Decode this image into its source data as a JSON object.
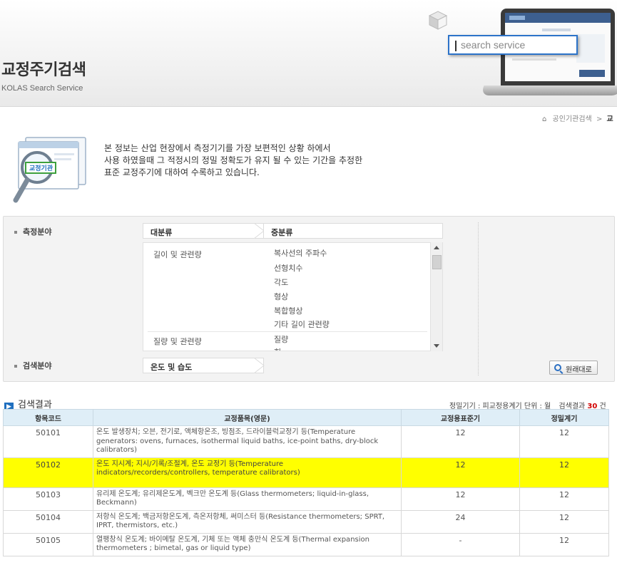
{
  "header": {
    "title": "교정주기검색",
    "subtitle": "KOLAS Search Service",
    "search_placeholder": "search service"
  },
  "breadcrumb": {
    "home_item": "공인기관검색",
    "current": "교"
  },
  "intro": {
    "badge_text": "교정기관",
    "lines": [
      "본 정보는 산업 현장에서 측정기기를 가장 보편적인 상황 하에서",
      "사용 하였을때 그 적정시의 정밀 정확도가 유지 될 수 있는 기간을 추정한",
      "표준 교정주기에 대하여 수록하고 있습니다."
    ]
  },
  "filter": {
    "field_label": "측정분야",
    "col_major": "대분류",
    "col_middle": "중분류",
    "categories": [
      "길이 및 관련량",
      "질량 및 관련량"
    ],
    "subcategories": [
      "복사선의 주파수",
      "선형치수",
      "각도",
      "형상",
      "복합형상",
      "기타 길이 관련량",
      "질량",
      "힘"
    ],
    "search_field_label": "검색분야",
    "search_field_value": "온도 및 습도",
    "reset_label": "원래대로"
  },
  "results": {
    "title": "검색결과",
    "unit_text": "정밀기기 : 피교정용계기 단위 : 월",
    "count_prefix": "검색결과",
    "count": "30",
    "count_suffix": "건",
    "columns": [
      "항목코드",
      "교정품목(영문)",
      "교정용표준기",
      "정밀계기"
    ],
    "rows": [
      {
        "code": "50101",
        "item": "온도 발생장치; 오븐, 전기로, 액체항온조, 빙점조, 드라이블럭교정기 등(Temperature generators: ovens, furnaces, isothermal liquid baths, ice-point baths, dry-block calibrators)",
        "standard": "12",
        "precision": "12"
      },
      {
        "code": "50102",
        "item": "온도 지시계; 지시/기록/조절계, 온도 교정기 등(Temperature indicators/recorders/controllers, temperature calibrators)",
        "standard": "12",
        "precision": "12"
      },
      {
        "code": "50103",
        "item": "유리제 온도계; 유리제온도계, 벡크만 온도계 등(Glass thermometers; liquid-in-glass, Beckmann)",
        "standard": "12",
        "precision": "12"
      },
      {
        "code": "50104",
        "item": "저항식 온도계; 백금저항온도계, 측온저항체, 써미스터 등(Resistance thermometers; SPRT, IPRT, thermistors, etc.)",
        "standard": "24",
        "precision": "12"
      },
      {
        "code": "50105",
        "item": "열팽창식 온도계; 바이메탈 온도계, 기체 또는 액체 충만식 온도계 등(Thermal expansion thermometers ; bimetal, gas or liquid type)",
        "standard": "-",
        "precision": "12"
      }
    ]
  },
  "colors": {
    "highlight": "#ffff00",
    "header_cell": "#dfeef7",
    "accent_blue": "#1f6fbf",
    "count_red": "#d10000"
  }
}
